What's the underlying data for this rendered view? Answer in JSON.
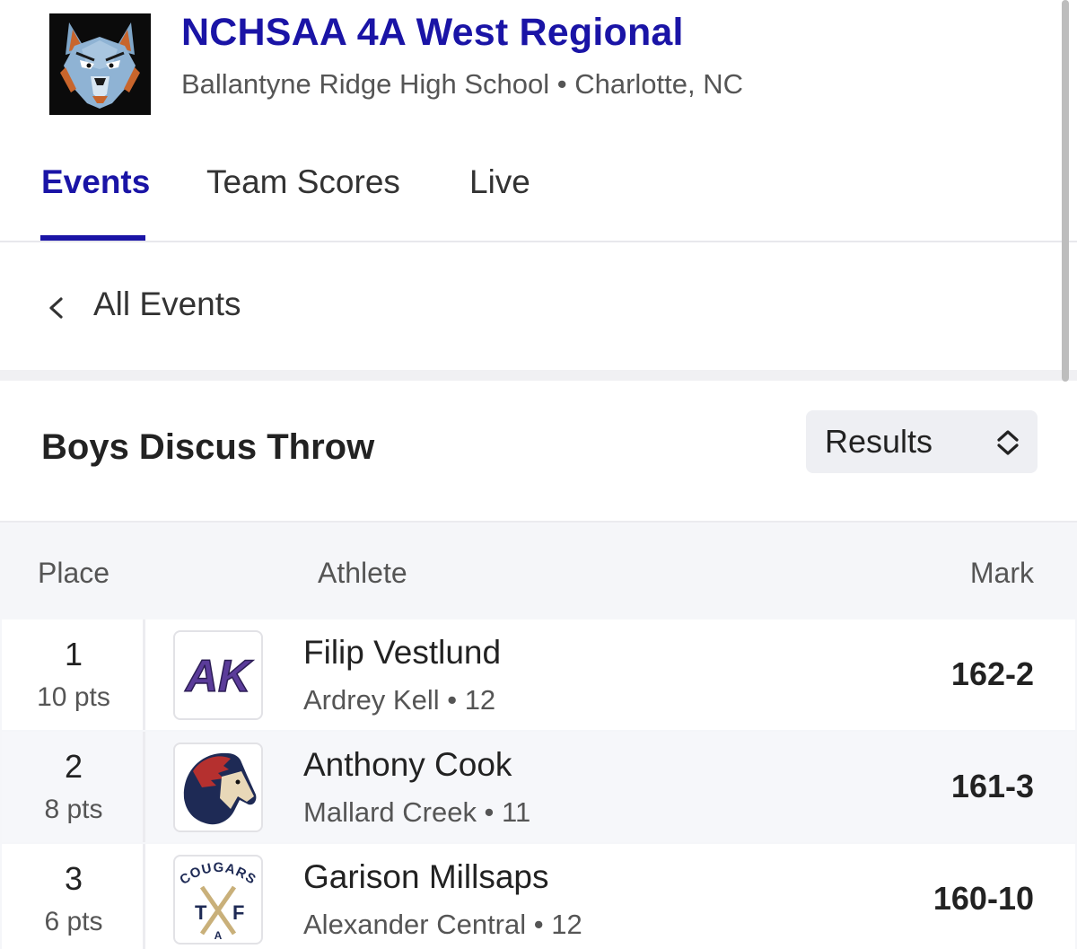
{
  "meet": {
    "title": "NCHSAA 4A West Regional",
    "subtitle": "Ballantyne Ridge High School • Charlotte, NC",
    "logo_icon": "wolf-logo"
  },
  "tabs": [
    {
      "label": "Events",
      "active": true
    },
    {
      "label": "Team Scores",
      "active": false
    },
    {
      "label": "Live",
      "active": false
    }
  ],
  "back": {
    "label": "All Events",
    "icon": "chevron-left-icon"
  },
  "event": {
    "title": "Boys Discus Throw",
    "view_select": {
      "value": "Results",
      "icon": "up-down-chevron-icon"
    }
  },
  "table": {
    "headers": {
      "place": "Place",
      "athlete": "Athlete",
      "mark": "Mark"
    },
    "rows": [
      {
        "place": "1",
        "points": "10 pts",
        "name": "Filip Vestlund",
        "meta": "Ardrey Kell • 12",
        "mark": "162-2",
        "logo": "ardrey-kell-ak-logo"
      },
      {
        "place": "2",
        "points": "8 pts",
        "name": "Anthony Cook",
        "meta": "Mallard Creek • 11",
        "mark": "161-3",
        "logo": "mallard-creek-mustang-logo"
      },
      {
        "place": "3",
        "points": "6 pts",
        "name": "Garison Millsaps",
        "meta": "Alexander Central • 12",
        "mark": "160-10",
        "logo": "alexander-central-cougars-logo",
        "logo_text": "COUGARS"
      }
    ]
  },
  "colors": {
    "brand": "#1a14a6",
    "text": "#222222",
    "muted": "#555555"
  }
}
